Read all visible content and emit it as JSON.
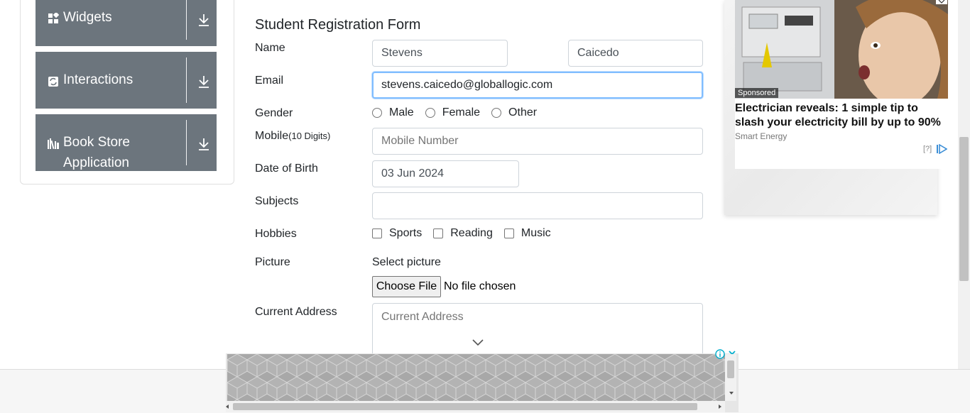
{
  "sidebar": {
    "groups": [
      {
        "label": "Widgets",
        "icon": "widgets-icon"
      },
      {
        "label": "Interactions",
        "icon": "interactions-icon"
      },
      {
        "label": "Book Store",
        "label2": "Application",
        "icon": "book-store-icon"
      }
    ],
    "download_icon": "download-arrow-icon"
  },
  "form": {
    "title": "Student Registration Form",
    "name_label": "Name",
    "first_name_value": "Stevens",
    "last_name_value": "Caicedo",
    "email_label": "Email",
    "email_value": "stevens.caicedo@globallogic.com",
    "gender_label": "Gender",
    "gender_options": [
      "Male",
      "Female",
      "Other"
    ],
    "mobile_label": "Mobile",
    "mobile_hint": "(10 Digits)",
    "mobile_placeholder": "Mobile Number",
    "dob_label": "Date of Birth",
    "dob_value": "03 Jun 2024",
    "subjects_label": "Subjects",
    "hobbies_label": "Hobbies",
    "hobbies_options": [
      "Sports",
      "Reading",
      "Music"
    ],
    "picture_label": "Picture",
    "select_picture": "Select picture",
    "choose_file": "Choose File",
    "file_status": "No file chosen",
    "address_label": "Current Address",
    "address_placeholder": "Current Address"
  },
  "ad_right": {
    "sponsored": "Sponsored",
    "headline": "Electrician reveals: 1 simple tip to slash your electricity bill by up to 90%",
    "brand": "Smart Energy",
    "adchoices": "[?]"
  },
  "colors": {
    "sidebar_group": "#6c757d",
    "focus_border": "#80bdff",
    "input_border": "#ced4da"
  }
}
